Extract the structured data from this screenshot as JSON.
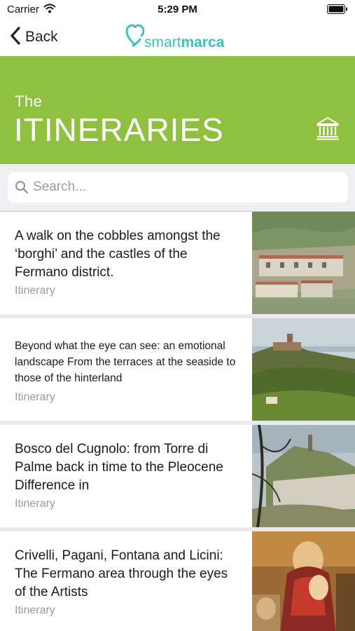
{
  "status_bar": {
    "carrier": "Carrier",
    "time": "5:29 PM"
  },
  "nav": {
    "back_label": "Back",
    "logo_part1": "smart",
    "logo_part2": "marca",
    "logo_color": "#3dbfc4"
  },
  "header": {
    "kicker": "The",
    "title": "ITINERARIES",
    "background_color": "#8fc03f",
    "icon": "museum-icon"
  },
  "search": {
    "placeholder": "Search...",
    "value": ""
  },
  "itineraries": [
    {
      "title": "A walk on the cobbles amongst the ‘borghi’ and the castles  of the Fermano district.",
      "type": "Itinerary"
    },
    {
      "title": "Beyond what the eye can see: an emotional landscape From the terraces at the seaside to those of the hinterland",
      "type": "Itinerary"
    },
    {
      "title": "Bosco del Cugnolo: from Torre di Palme back in time to the Pleocene Difference in",
      "type": "Itinerary"
    },
    {
      "title": "Crivelli, Pagani, Fontana and Licini:  The Fermano area through the eyes of the Artists",
      "type": "Itinerary"
    }
  ]
}
